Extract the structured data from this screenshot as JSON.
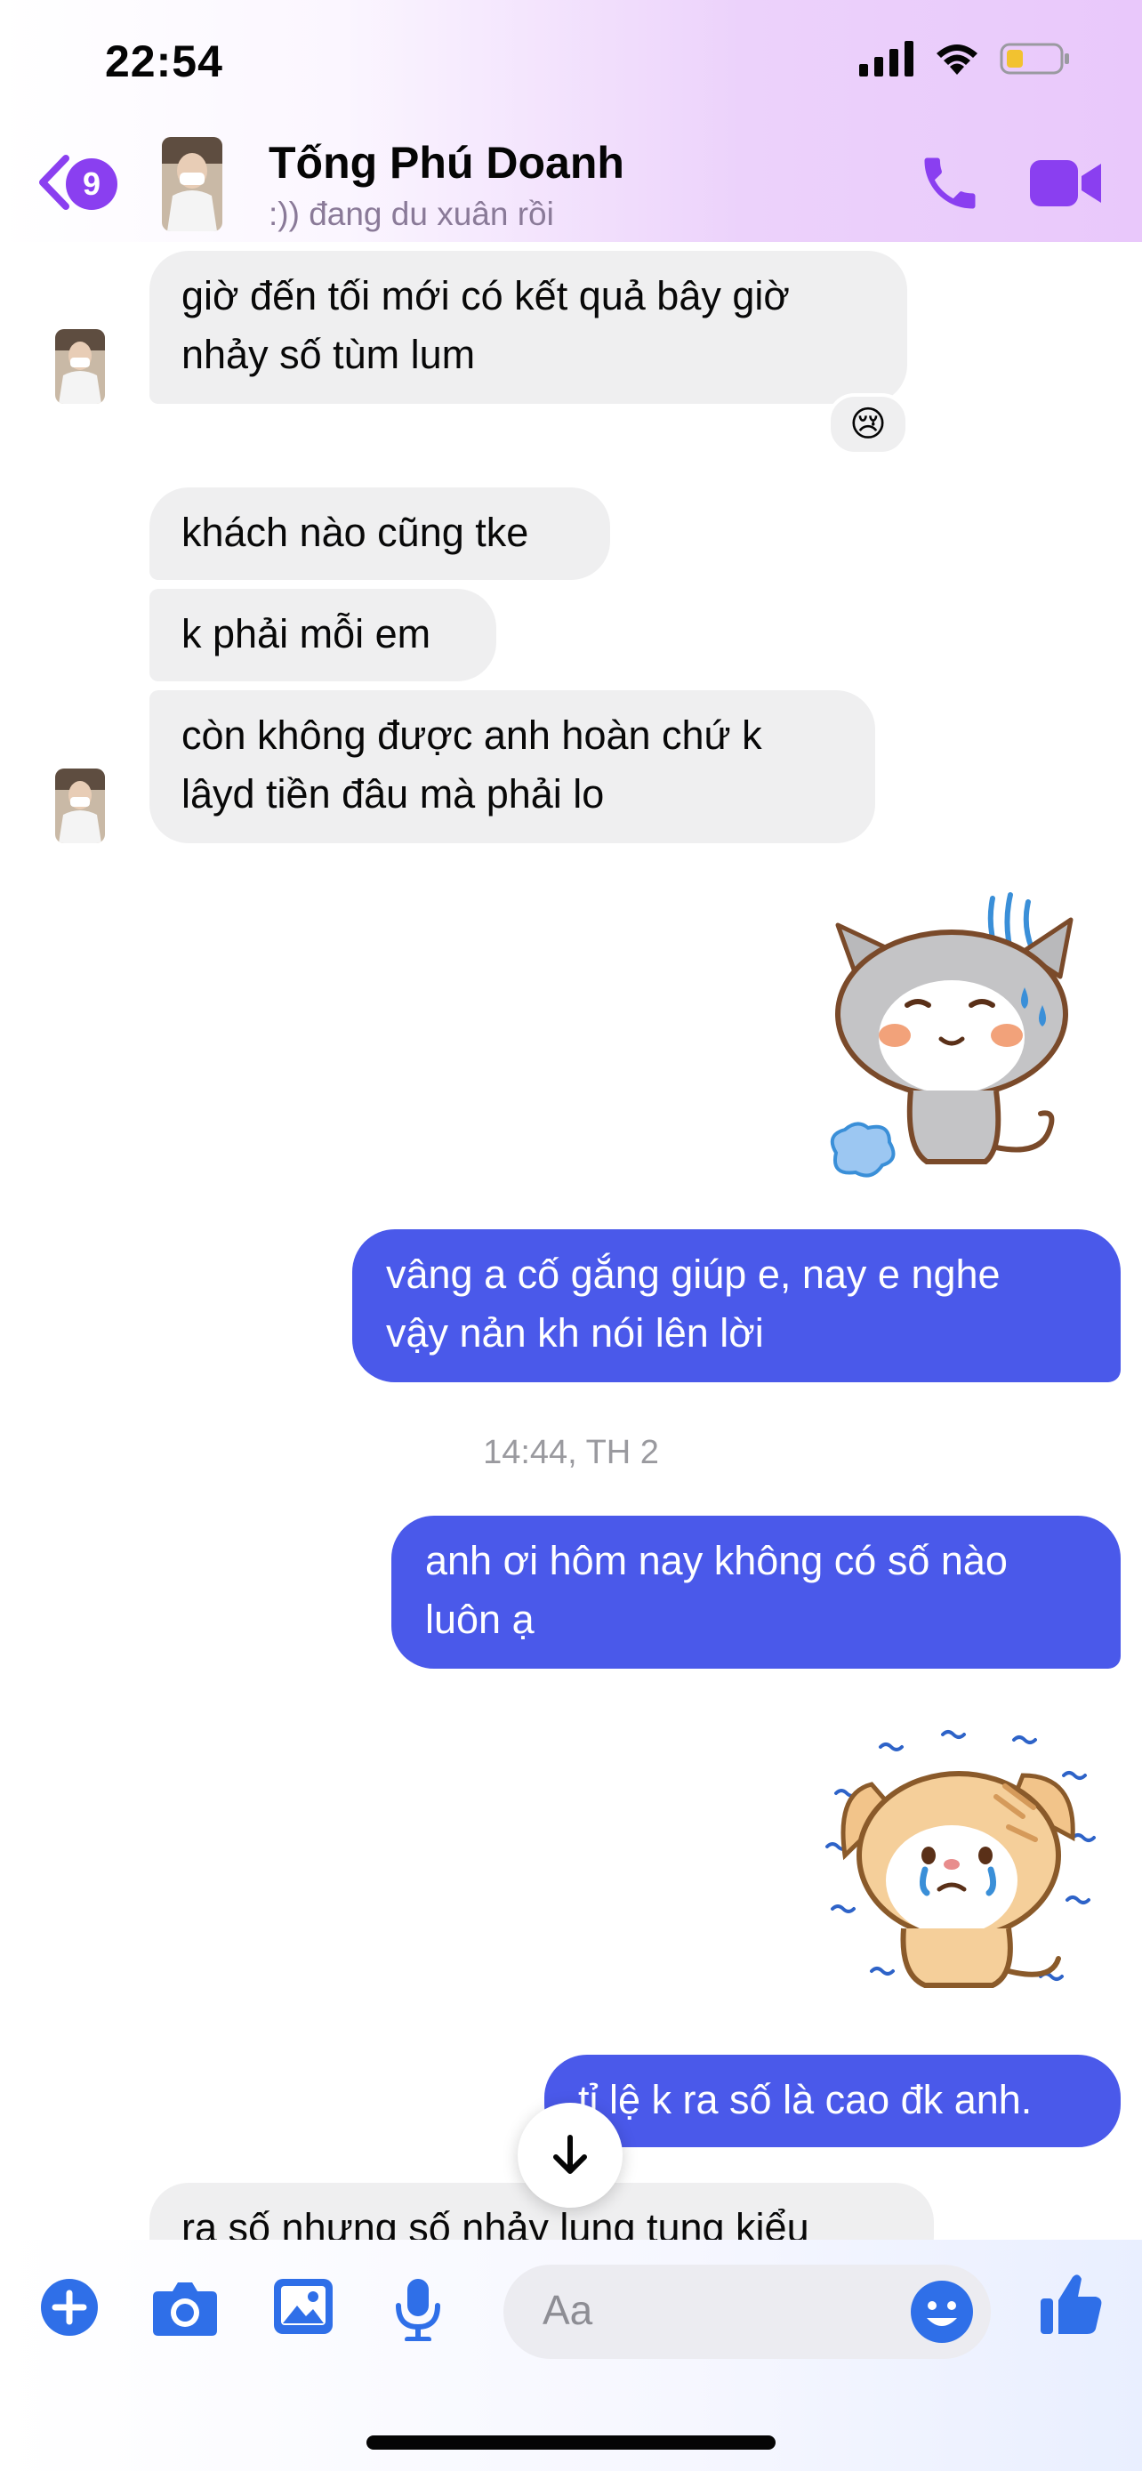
{
  "status_bar": {
    "time": "22:54"
  },
  "header": {
    "back_badge": "9",
    "contact_name": "Tống Phú Doanh",
    "contact_status": ":)) đang du xuân rồi"
  },
  "messages": [
    {
      "side": "in",
      "text_lines": [
        "giờ đến tối mới có kết quả bây giờ",
        "nhảy số tùm lum"
      ],
      "reaction": "😢"
    },
    {
      "side": "in",
      "text_lines": [
        "khách nào cũng tke"
      ]
    },
    {
      "side": "in",
      "text_lines": [
        "k phải mỗi em"
      ]
    },
    {
      "side": "in",
      "text_lines": [
        "còn không được anh hoàn chứ k",
        "lâyd tiền đâu mà phải lo"
      ]
    },
    {
      "side": "out",
      "type": "sticker",
      "sticker": "sweating-gray-cat"
    },
    {
      "side": "out",
      "text_lines": [
        "vâng a cố gắng giúp e, nay e nghe",
        "vậy nản kh nói lên lời"
      ]
    },
    {
      "type": "timestamp",
      "text": "14:44, TH 2"
    },
    {
      "side": "out",
      "text_lines": [
        "anh ơi hôm nay không có số nào",
        "luôn ạ"
      ]
    },
    {
      "side": "out",
      "type": "sticker",
      "sticker": "crying-orange-cat"
    },
    {
      "side": "out",
      "text_lines": [
        "tỉ lệ k ra số là cao đk anh."
      ]
    },
    {
      "side": "in",
      "text_lines": [
        "ra số nhưng số nhảy lung tung kiểu"
      ]
    }
  ],
  "composer": {
    "placeholder": "Aa",
    "icons": [
      "plus-icon",
      "camera-icon",
      "image-icon",
      "microphone-icon",
      "emoji-icon",
      "thumbs-up-icon"
    ]
  },
  "colors": {
    "accent": "#8a3ff0",
    "outgoing_bubble": "#4a59ea",
    "incoming_bubble": "#efeff0",
    "composer_icon": "#2f6fe8"
  }
}
